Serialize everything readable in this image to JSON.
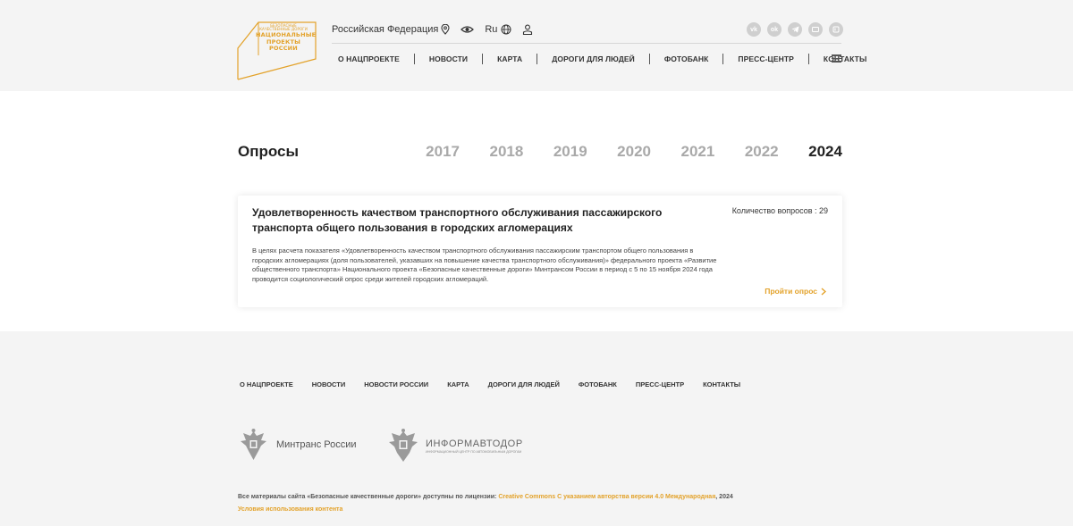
{
  "header": {
    "logo": {
      "line1": "БЕЗОПАСНЫЕ",
      "line2": "КАЧЕСТВЕННЫЕ ДОРОГИ",
      "line3": "НАЦИОНАЛЬНЫЕ",
      "line4": "ПРОЕКТЫ",
      "line5": "РОССИИ"
    },
    "region": "Российская Федерация",
    "language": "Ru",
    "socials": [
      "vk",
      "ok",
      "tg",
      "rt",
      "dz"
    ],
    "nav": [
      "О НАЦПРОЕКТЕ",
      "НОВОСТИ",
      "КАРТА",
      "ДОРОГИ ДЛЯ ЛЮДЕЙ",
      "ФОТОБАНК",
      "ПРЕСС-ЦЕНТР",
      "КОНТАКТЫ"
    ]
  },
  "main": {
    "title": "Опросы",
    "years": [
      "2017",
      "2018",
      "2019",
      "2020",
      "2021",
      "2022",
      "2024"
    ],
    "active_year": "2024",
    "survey": {
      "title": "Удовлетворенность качеством транспортного обслуживания пассажирского транспорта общего пользования в городских агломерациях",
      "count_label": "Количество вопросов : 29",
      "description": "В целях расчета показателя «Удовлетворенность качеством транспортного обслуживания пассажирским транспортом общего пользования в городских агломерациях (доля пользователей, указавших на повышение качества транспортного обслуживания)» федерального проекта «Развитие общественного транспорта» Национального проекта «Безопасные качественные дороги» Минтрансом России в период с 5 по 15 ноября 2024 года проводится социологический опрос среди жителей городских агломераций.",
      "link": "Пройти опрос"
    }
  },
  "footer": {
    "nav": [
      "О НАЦПРОЕКТЕ",
      "НОВОСТИ",
      "НОВОСТИ РОССИИ",
      "КАРТА",
      "ДОРОГИ ДЛЯ ЛЮДЕЙ",
      "ФОТОБАНК",
      "ПРЕСС-ЦЕНТР",
      "КОНТАКТЫ"
    ],
    "partner1": "Минтранс России",
    "partner2": "ИНФОРМАВТОДОР",
    "partner2_sub": "ИНФОРМАЦИОННЫЙ ЦЕНТР ПО АВТОМОБИЛЬНЫМ ДОРОГАМ",
    "license_prefix": "Все материалы сайта «Безопасные качественные дороги» доступны по лицензии:",
    "license_link": "Creative Commons С указанием авторства версии 4.0 Международная",
    "license_year": ", 2024",
    "terms": "Условия использования контента"
  },
  "colors": {
    "accent": "#e3a22a",
    "header_bg": "#f4f4f4",
    "inactive_year": "#a9a9a9"
  }
}
